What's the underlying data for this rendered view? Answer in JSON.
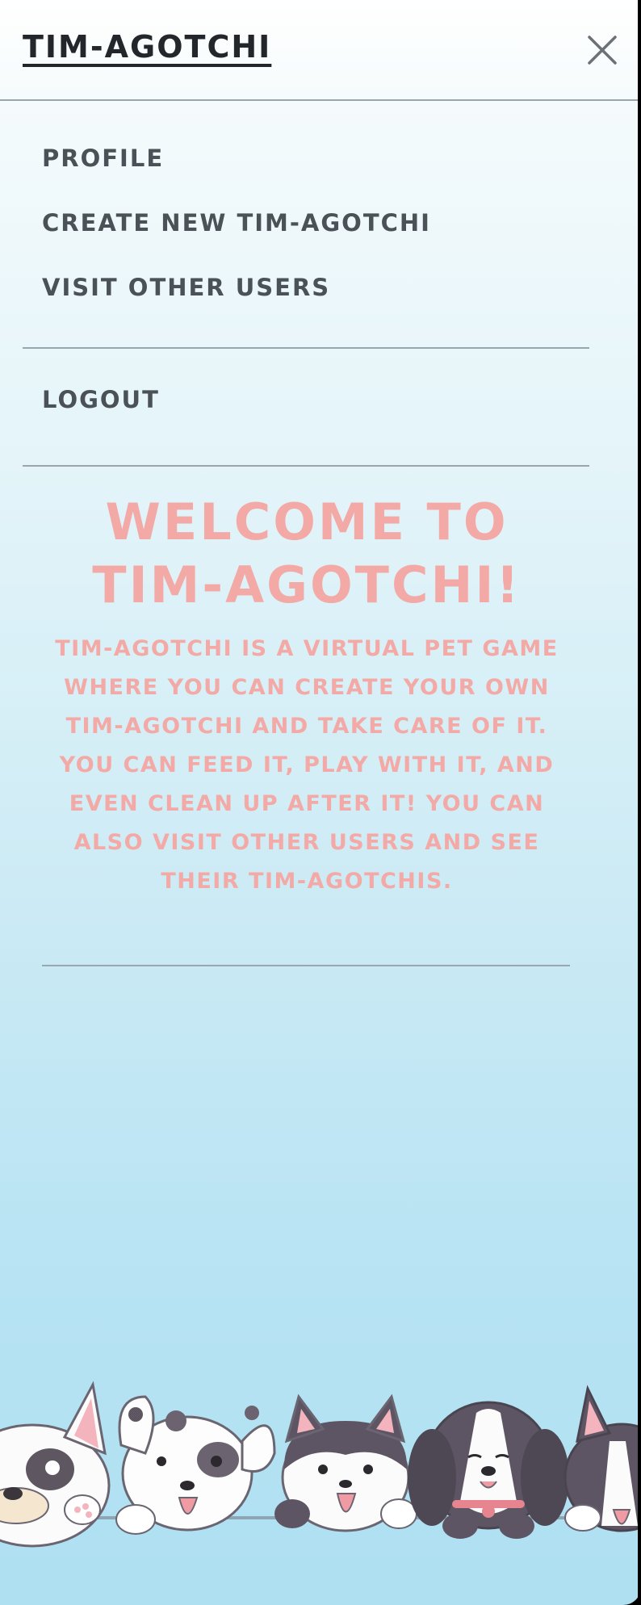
{
  "header": {
    "brand": "TIM-AGOTCHI",
    "close_icon": "close-icon"
  },
  "nav": {
    "items": [
      {
        "label": "PROFILE"
      },
      {
        "label": "CREATE NEW TIM-AGOTCHI"
      },
      {
        "label": "VISIT OTHER USERS"
      }
    ],
    "logout": "LOGOUT"
  },
  "welcome": {
    "title": "WELCOME TO TIM-AGOTCHI!",
    "body": "TIM-AGOTCHI IS A VIRTUAL PET GAME WHERE YOU CAN CREATE YOUR OWN TIM-AGOTCHI AND TAKE CARE OF IT. YOU CAN FEED IT, PLAY WITH IT, AND EVEN CLEAN UP AFTER IT! YOU CAN ALSO VISIT OTHER USERS AND SEE THEIR TIM-AGOTCHIS."
  },
  "colors": {
    "brand_text": "#23272b",
    "nav_text": "#4a5157",
    "accent_pink": "#f3aaa6",
    "divider": "#9aa6ad"
  },
  "illustration": {
    "name": "puppies-illustration"
  }
}
